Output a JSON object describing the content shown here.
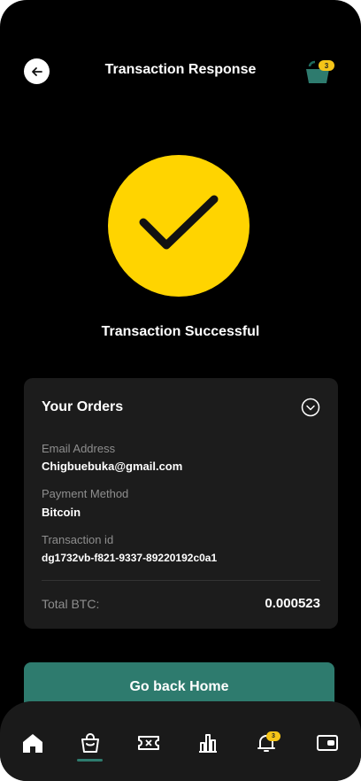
{
  "header": {
    "title": "Transaction Response",
    "cart_count": "3"
  },
  "status": {
    "message": "Transaction Successful"
  },
  "orders": {
    "title": "Your Orders",
    "fields": [
      {
        "label": "Email Address",
        "value": "Chigbuebuka@gmail.com"
      },
      {
        "label": "Payment Method",
        "value": "Bitcoin"
      },
      {
        "label": "Transaction id",
        "value": "dg1732vb-f821-9337-89220192c0a1"
      }
    ],
    "total_label": "Total BTC:",
    "total_value": "0.000523"
  },
  "actions": {
    "home_label": "Go back Home"
  },
  "nav": {
    "items": [
      "home-icon",
      "shopping-bag-icon",
      "ticket-icon",
      "stats-icon",
      "bell-icon",
      "wallet-icon"
    ],
    "active": "shopping-bag-icon",
    "notification_count": "3"
  },
  "colors": {
    "accent": "#2e7b6e",
    "success": "#ffd400",
    "badge": "#f5c518"
  }
}
